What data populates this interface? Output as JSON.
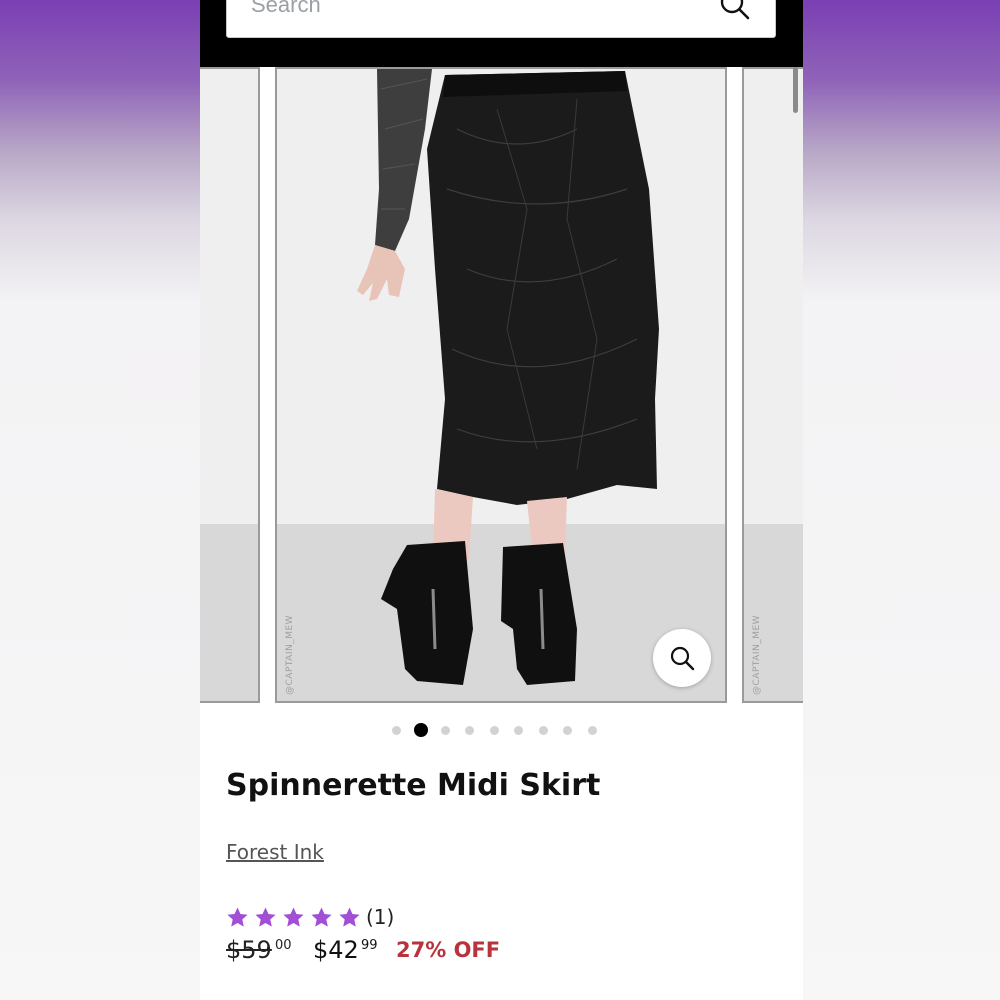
{
  "search": {
    "placeholder": "Search"
  },
  "gallery": {
    "watermark": "@CAPTAIN_MEW",
    "dot_count": 9,
    "active_index": 1
  },
  "product": {
    "title": "Spinnerette Midi Skirt",
    "brand": "Forest Ink",
    "rating": 5,
    "review_count": "(1)",
    "original_price": "$59",
    "original_cents": "00",
    "sale_price": "$42",
    "sale_cents": "99",
    "discount": "27% OFF"
  },
  "colors": {
    "star": "#a14fd6",
    "discount": "#b8343c",
    "header": "#000000"
  },
  "icons": {
    "search": "search-icon",
    "zoom": "zoom-icon",
    "star": "star-icon"
  }
}
